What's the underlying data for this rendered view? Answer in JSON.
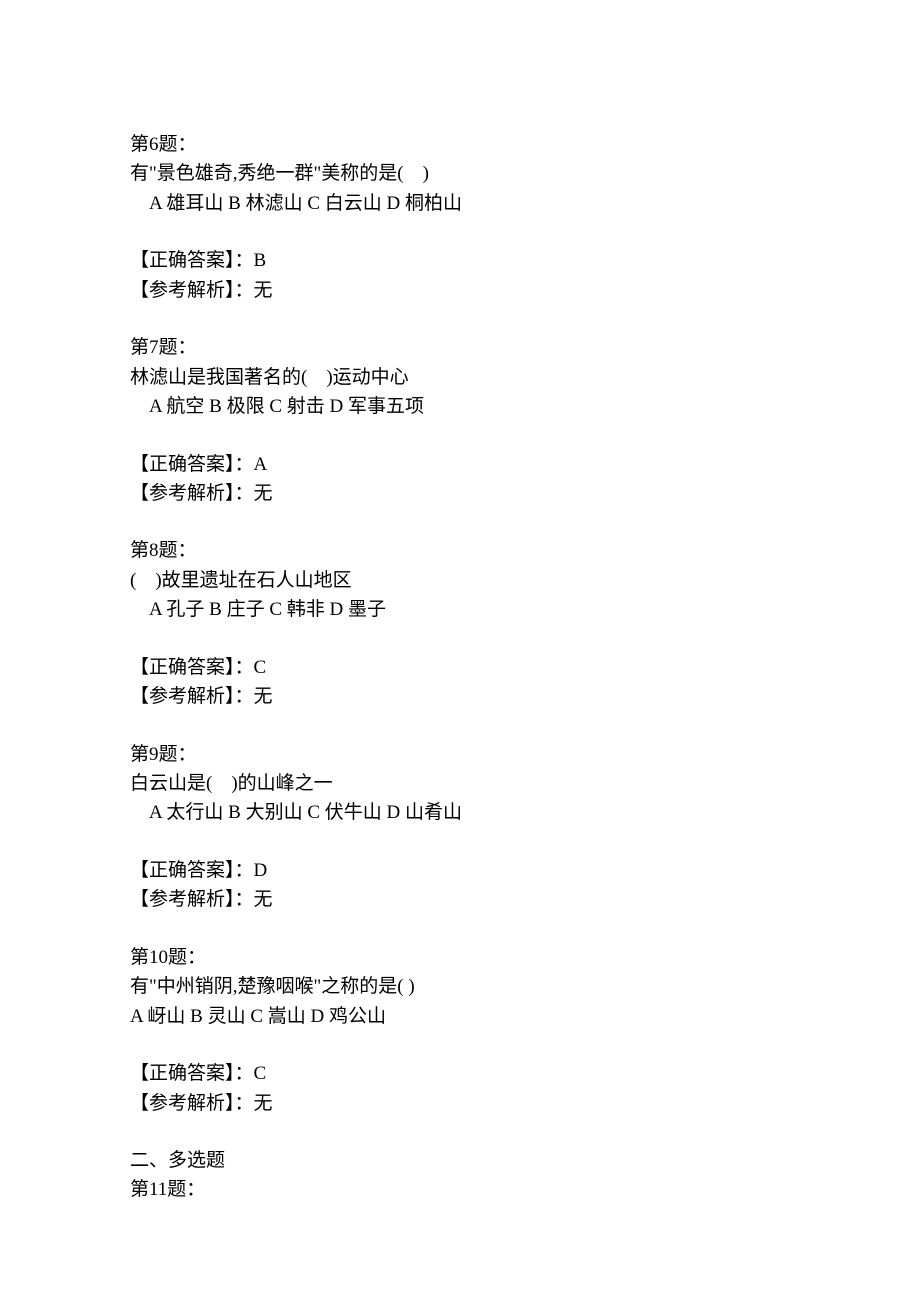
{
  "questions": [
    {
      "header": "第6题：",
      "stem": "有\"景色雄奇,秀绝一群\"美称的是(　)",
      "options": "　A 雄耳山 B 林滤山 C 白云山 D 桐柏山",
      "answerLabel": "【正确答案】：B",
      "explain": "【参考解析】：无"
    },
    {
      "header": "第7题：",
      "stem": "林滤山是我国著名的(　)运动中心",
      "options": "　A 航空 B 极限 C 射击 D 军事五项",
      "answerLabel": "【正确答案】：A",
      "explain": "【参考解析】：无"
    },
    {
      "header": "第8题：",
      "stem": "(　)故里遗址在石人山地区",
      "options": "　A 孔子 B 庄子 C 韩非 D 墨子",
      "answerLabel": "【正确答案】：C",
      "explain": "【参考解析】：无"
    },
    {
      "header": "第9题：",
      "stem": "白云山是(　)的山峰之一",
      "options": "　A 太行山 B 大别山 C 伏牛山 D 山肴山",
      "answerLabel": "【正确答案】：D",
      "explain": "【参考解析】：无"
    },
    {
      "header": "第10题：",
      "stem": "有\"中州销阴,楚豫咽喉\"之称的是( )",
      "options": "A 岈山 B 灵山 C 嵩山 D 鸡公山",
      "answerLabel": "【正确答案】：C",
      "explain": "【参考解析】：无"
    }
  ],
  "section2": "二、多选题",
  "q11header": "第11题："
}
